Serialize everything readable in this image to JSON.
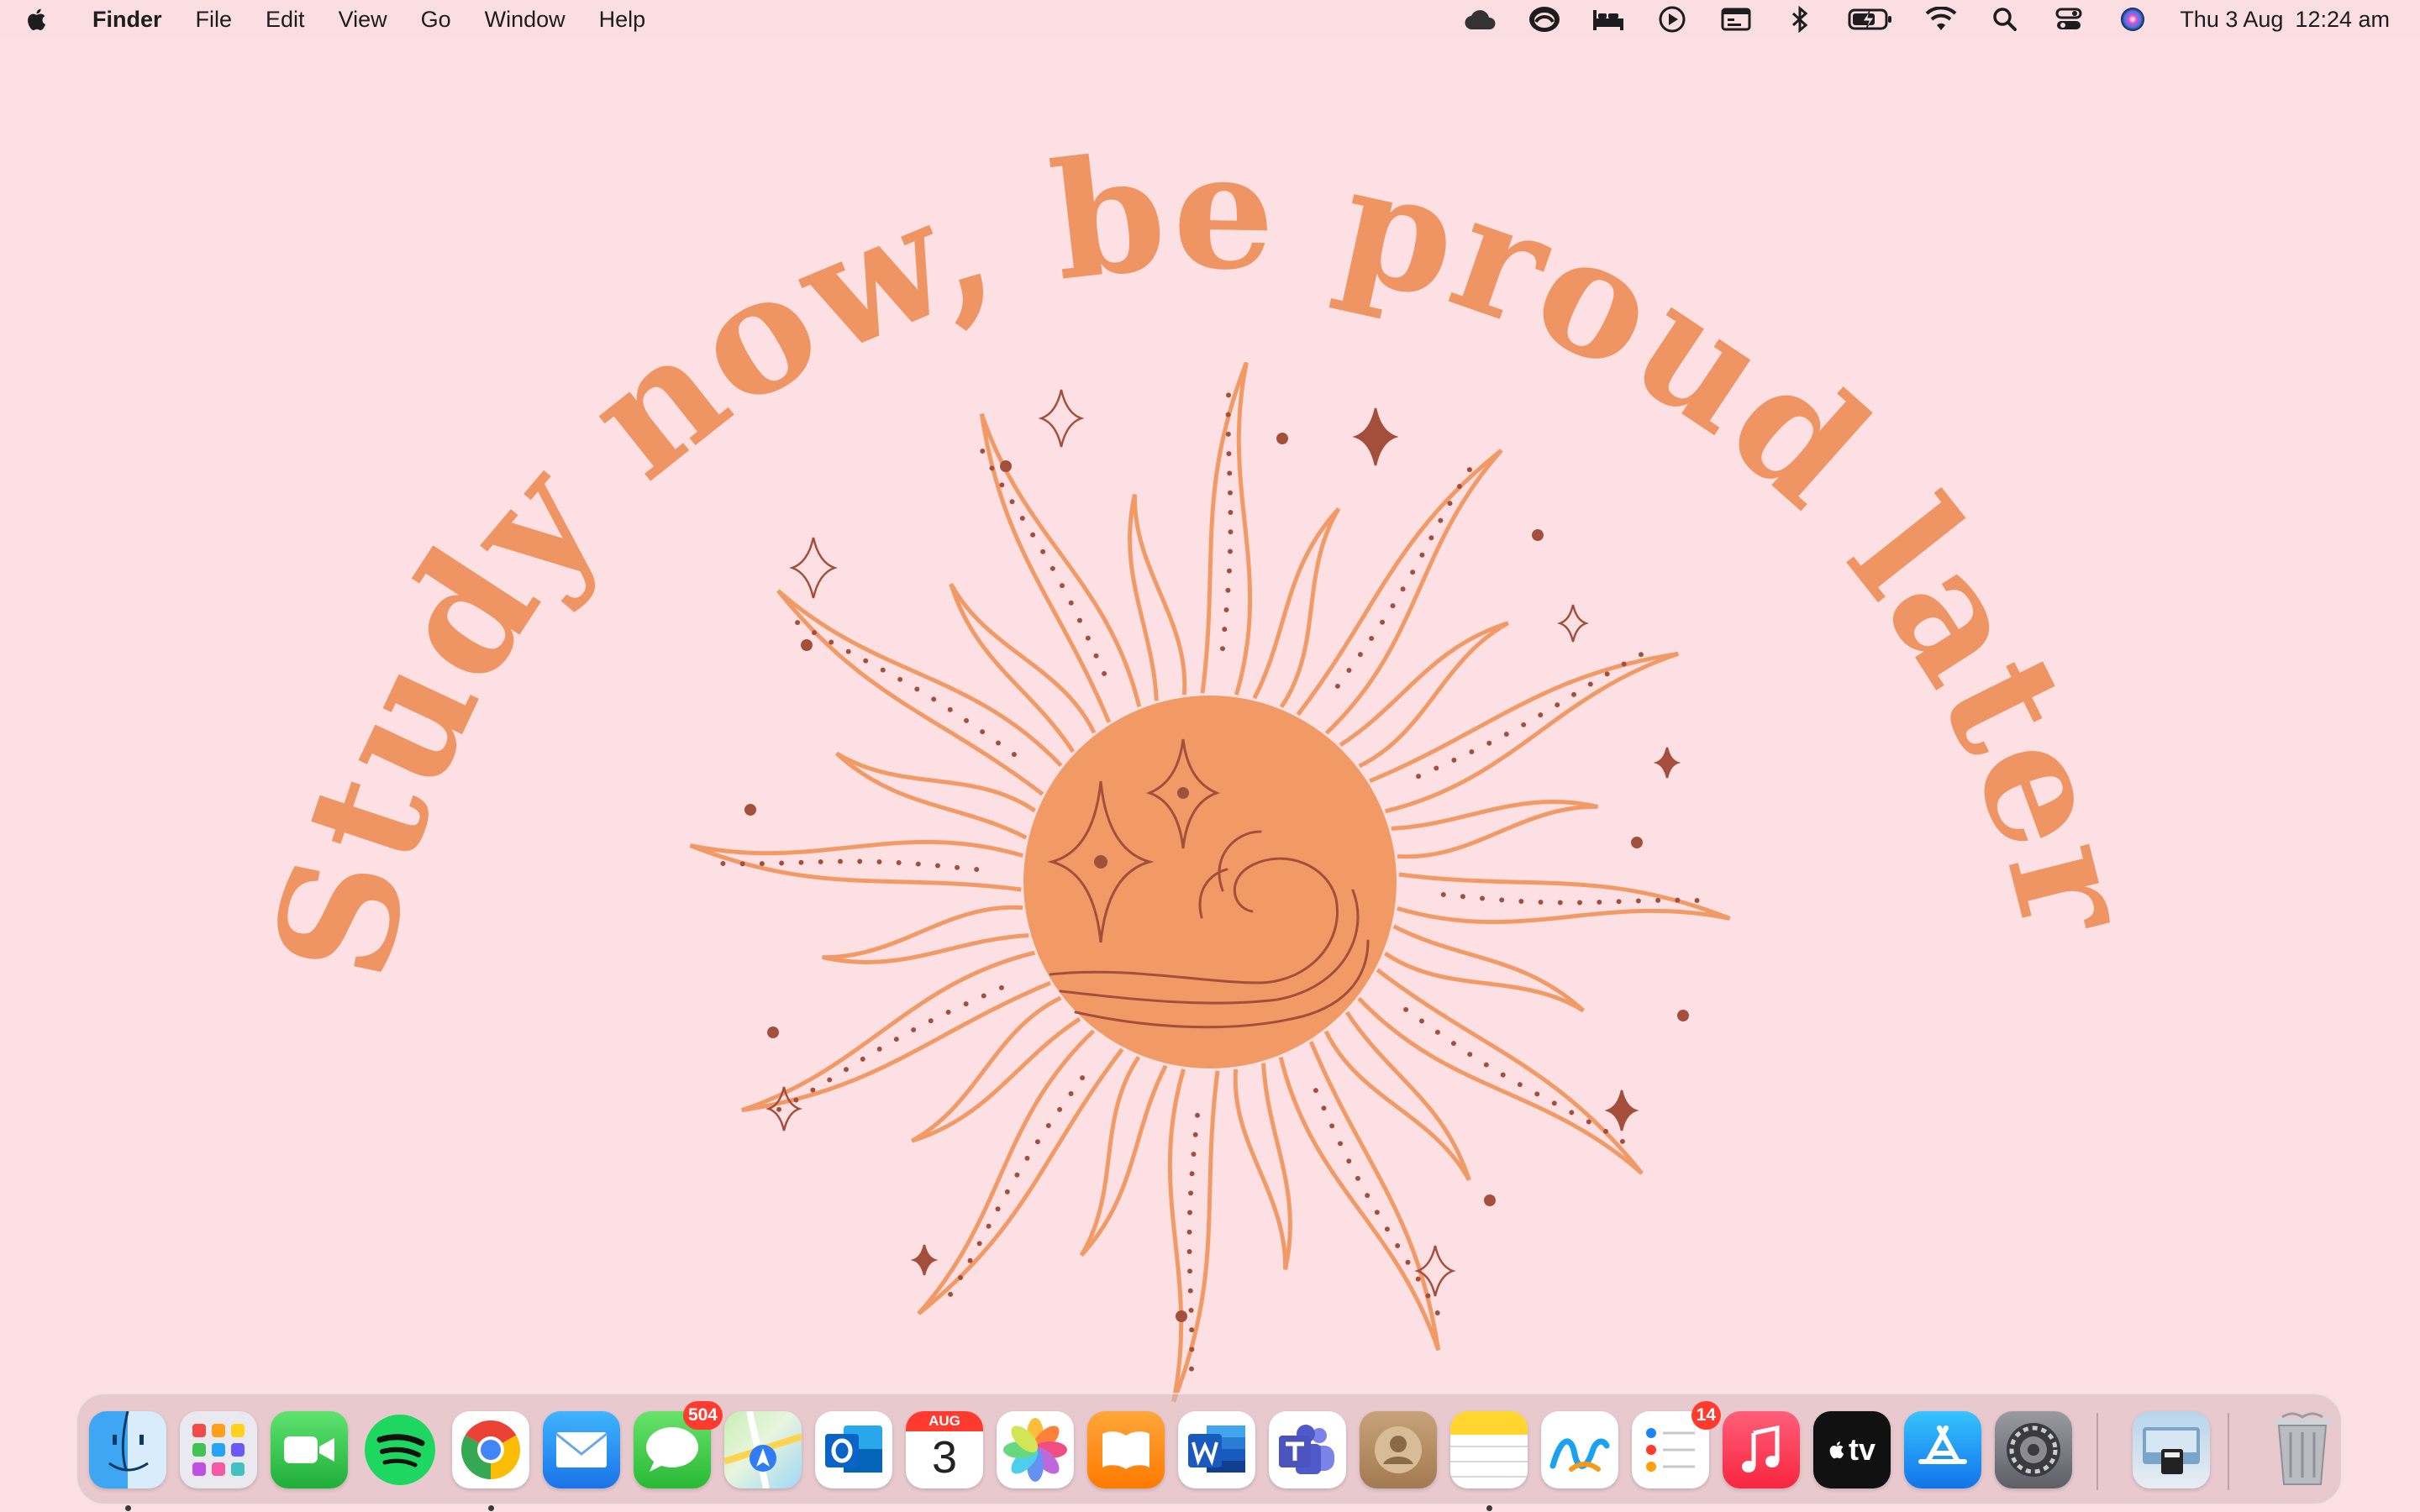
{
  "menubar": {
    "app_name": "Finder",
    "items": [
      "File",
      "Edit",
      "View",
      "Go",
      "Window",
      "Help"
    ],
    "status_icons": [
      "creative-cloud-icon",
      "cloud-sync-icon",
      "sleep-bed-icon",
      "play-icon",
      "screen-capture-icon",
      "bluetooth-icon",
      "battery-icon",
      "wifi-icon",
      "spotlight-search-icon",
      "control-center-icon",
      "siri-icon"
    ],
    "date": "Thu 3 Aug",
    "time": "12:24 am"
  },
  "wallpaper": {
    "quote": "Study now, be proud later.",
    "colors": {
      "background": "#fde0e4",
      "text": "#ef9563",
      "sun": "#f19a66",
      "accent": "#a44f3c"
    }
  },
  "dock": {
    "apps": [
      {
        "name": "Finder",
        "icon": "finder-icon",
        "running": true
      },
      {
        "name": "Launchpad",
        "icon": "launchpad-icon"
      },
      {
        "name": "FaceTime",
        "icon": "facetime-icon"
      },
      {
        "name": "Spotify",
        "icon": "spotify-icon"
      },
      {
        "name": "Google Chrome",
        "icon": "chrome-icon",
        "running": true
      },
      {
        "name": "Mail",
        "icon": "mail-icon"
      },
      {
        "name": "Messages",
        "icon": "messages-icon",
        "badge": "504"
      },
      {
        "name": "Maps",
        "icon": "maps-icon"
      },
      {
        "name": "Microsoft Outlook",
        "icon": "outlook-icon"
      },
      {
        "name": "Calendar",
        "icon": "calendar-icon",
        "month": "AUG",
        "day": "3"
      },
      {
        "name": "Photos",
        "icon": "photos-icon"
      },
      {
        "name": "Books",
        "icon": "books-icon"
      },
      {
        "name": "Microsoft Word",
        "icon": "word-icon"
      },
      {
        "name": "Microsoft Teams",
        "icon": "teams-icon"
      },
      {
        "name": "Contacts",
        "icon": "contacts-icon"
      },
      {
        "name": "Notes",
        "icon": "notes-icon",
        "running": true
      },
      {
        "name": "Freeform",
        "icon": "freeform-icon"
      },
      {
        "name": "Reminders",
        "icon": "reminders-icon",
        "badge": "14"
      },
      {
        "name": "Music",
        "icon": "music-icon"
      },
      {
        "name": "TV",
        "icon": "apple-tv-icon",
        "label": "tv"
      },
      {
        "name": "App Store",
        "icon": "app-store-icon"
      },
      {
        "name": "System Settings",
        "icon": "system-settings-icon"
      },
      {
        "name": "Downloads",
        "icon": "downloads-stack-icon"
      },
      {
        "name": "Trash",
        "icon": "trash-icon"
      }
    ]
  }
}
